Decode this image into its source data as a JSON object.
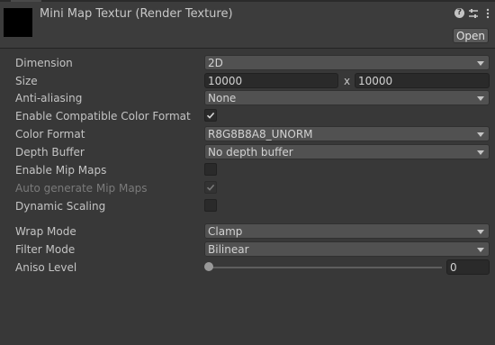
{
  "header": {
    "title": "Mini Map Textur (Render Texture)",
    "open_label": "Open",
    "icons": [
      "help-icon",
      "preset-icon",
      "more-icon"
    ]
  },
  "properties": {
    "dimension": {
      "label": "Dimension",
      "value": "2D"
    },
    "size": {
      "label": "Size",
      "width": "10000",
      "separator": "x",
      "height": "10000"
    },
    "anti_aliasing": {
      "label": "Anti-aliasing",
      "value": "None"
    },
    "compatible_format": {
      "label": "Enable Compatible Color Format",
      "checked": true
    },
    "color_format": {
      "label": "Color Format",
      "value": "R8G8B8A8_UNORM"
    },
    "depth_buffer": {
      "label": "Depth Buffer",
      "value": "No depth buffer"
    },
    "mip_maps": {
      "label": "Enable Mip Maps",
      "checked": false
    },
    "auto_mip": {
      "label": "Auto generate Mip Maps",
      "checked": true,
      "disabled": true
    },
    "dynamic_scaling": {
      "label": "Dynamic Scaling",
      "checked": false
    },
    "wrap_mode": {
      "label": "Wrap Mode",
      "value": "Clamp"
    },
    "filter_mode": {
      "label": "Filter Mode",
      "value": "Bilinear"
    },
    "aniso_level": {
      "label": "Aniso Level",
      "value": "0",
      "slider_fraction": 0
    }
  }
}
